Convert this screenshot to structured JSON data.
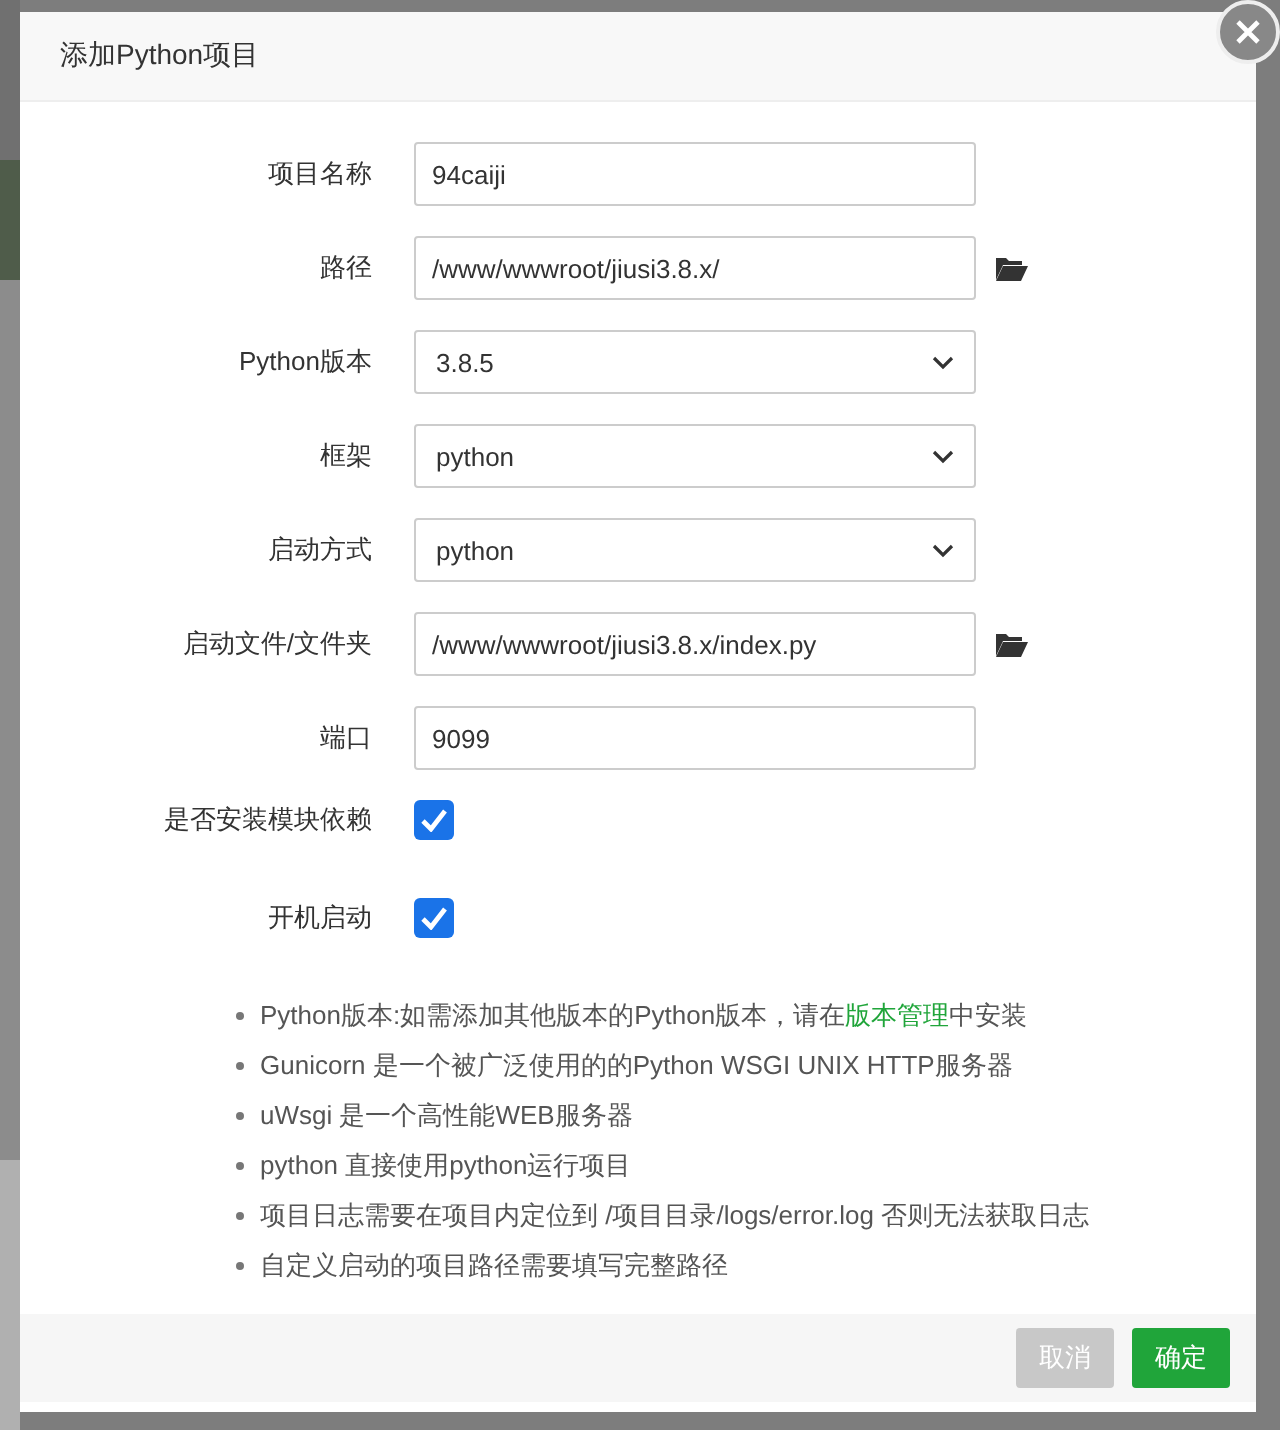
{
  "dialog": {
    "title": "添加Python项目",
    "fields": [
      {
        "kind": "text",
        "label": "项目名称",
        "value": "94caiji",
        "browse": false
      },
      {
        "kind": "text",
        "label": "路径",
        "value": "/www/wwwroot/jiusi3.8.x/",
        "browse": true
      },
      {
        "kind": "select",
        "label": "Python版本",
        "value": "3.8.5"
      },
      {
        "kind": "select",
        "label": "框架",
        "value": "python"
      },
      {
        "kind": "select",
        "label": "启动方式",
        "value": "python"
      },
      {
        "kind": "text",
        "label": "启动文件/文件夹",
        "value": "/www/wwwroot/jiusi3.8.x/index.py",
        "browse": true
      },
      {
        "kind": "text",
        "label": "端口",
        "value": "9099",
        "browse": false
      },
      {
        "kind": "checkbox",
        "label": "是否安装模块依赖",
        "checked": true
      },
      {
        "kind": "checkbox",
        "label": "开机启动",
        "checked": true
      }
    ],
    "notes": [
      {
        "text": "Python版本:如需添加其他版本的Python版本，请在",
        "link": "版本管理",
        "after": "中安装"
      },
      {
        "text": "Gunicorn 是一个被广泛使用的的Python WSGI UNIX HTTP服务器"
      },
      {
        "text": "uWsgi 是一个高性能WEB服务器"
      },
      {
        "text": "python 直接使用python运行项目"
      },
      {
        "text": "项目日志需要在项目内定位到 /项目目录/logs/error.log 否则无法获取日志"
      },
      {
        "text": "自定义启动的项目路径需要填写完整路径"
      }
    ],
    "buttons": [
      {
        "kind": "cancel",
        "label": "取消"
      },
      {
        "kind": "primary",
        "label": "确定"
      }
    ]
  }
}
